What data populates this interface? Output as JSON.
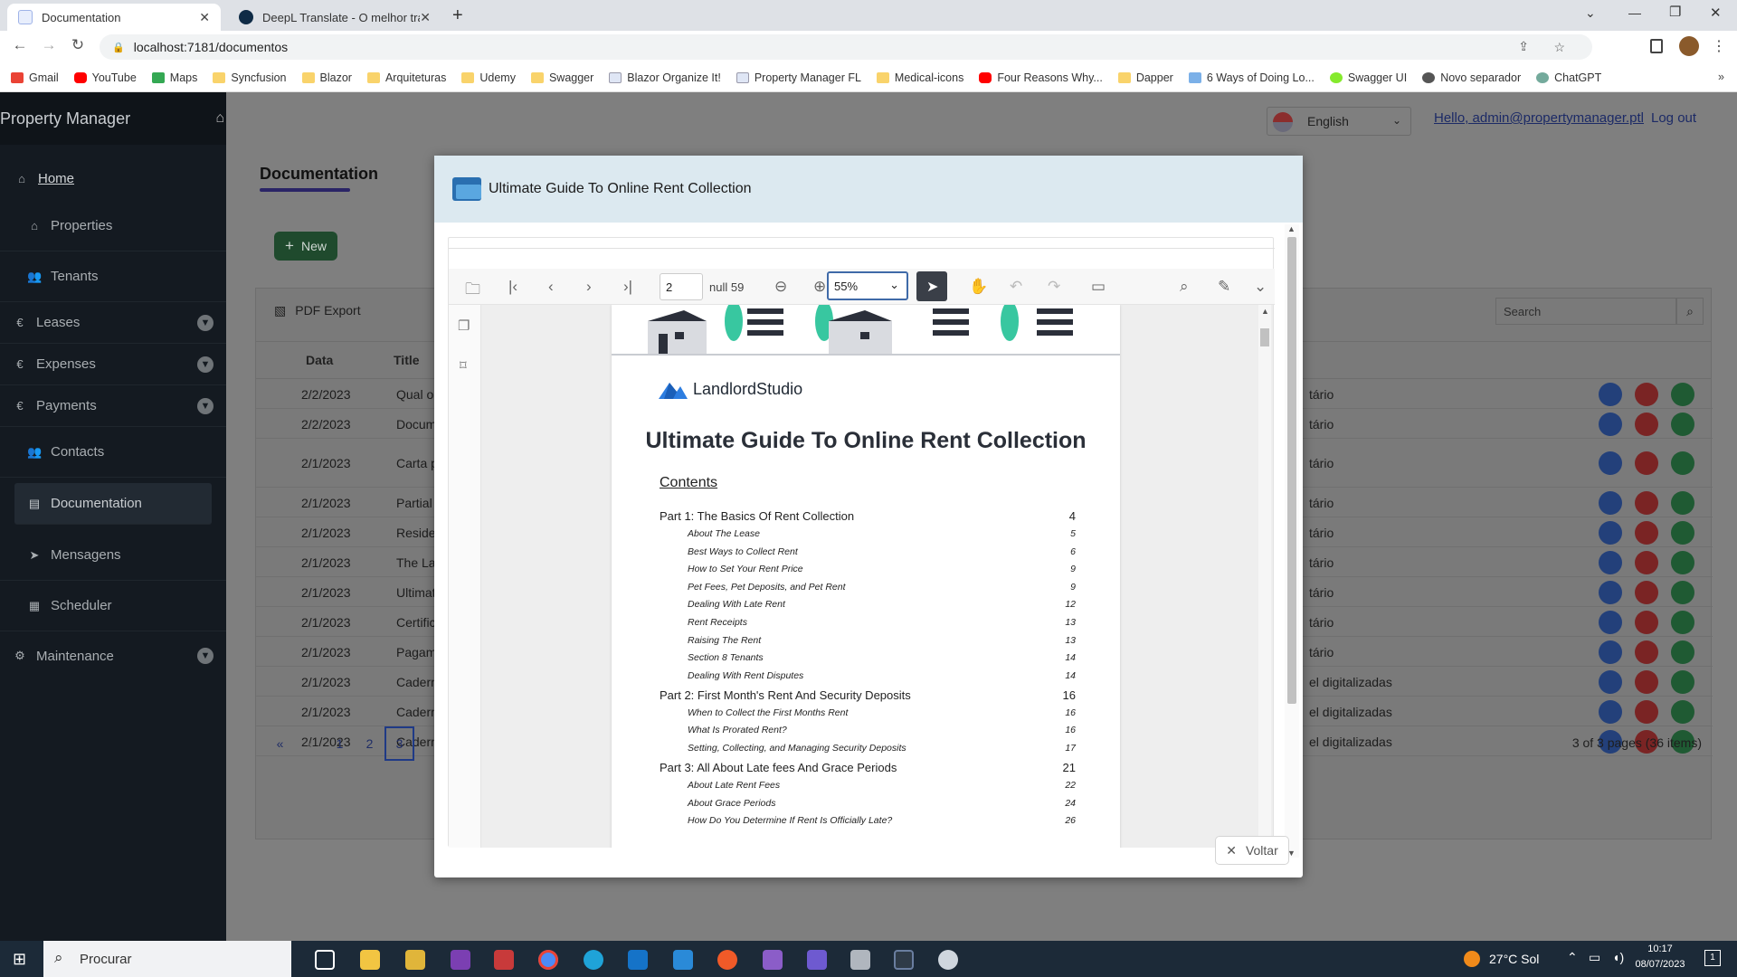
{
  "browser": {
    "tabs": [
      {
        "title": "Documentation",
        "active": true
      },
      {
        "title": "DeepL Translate - O melhor tradu",
        "active": false
      }
    ],
    "new_tab": "+",
    "url": "localhost:7181/documentos",
    "bookmarks": [
      "Gmail",
      "YouTube",
      "Maps",
      "Syncfusion",
      "Blazor",
      "Arquiteturas",
      "Udemy",
      "Swagger",
      "Blazor Organize It!",
      "Property Manager FL",
      "Medical-icons",
      "Four Reasons Why...",
      "Dapper",
      "6 Ways of Doing Lo...",
      "Swagger UI",
      "Novo separador",
      "ChatGPT"
    ]
  },
  "app": {
    "brand": "Property Manager",
    "sidebar": [
      {
        "label": "Home",
        "icon": "home-icon",
        "expandable": false
      },
      {
        "label": "Properties",
        "icon": "home-icon",
        "expandable": false
      },
      {
        "label": "Tenants",
        "icon": "users-icon",
        "expandable": false
      },
      {
        "label": "Leases",
        "icon": "euro-icon",
        "expandable": true
      },
      {
        "label": "Expenses",
        "icon": "euro-icon",
        "expandable": true
      },
      {
        "label": "Payments",
        "icon": "euro-icon",
        "expandable": true
      },
      {
        "label": "Contacts",
        "icon": "users-icon",
        "expandable": false
      },
      {
        "label": "Documentation",
        "icon": "document-icon",
        "expandable": false,
        "active": true
      },
      {
        "label": "Mensagens",
        "icon": "send-icon",
        "expandable": false
      },
      {
        "label": "Scheduler",
        "icon": "calendar-icon",
        "expandable": false
      },
      {
        "label": "Maintenance",
        "icon": "gear-icon",
        "expandable": true
      }
    ],
    "language": "English",
    "user_greeting": "Hello, admin@propertymanager.ptl",
    "logout": "Log out",
    "page_title": "Documentation",
    "new_button": "New",
    "pdf_export": "PDF Export",
    "search_placeholder": "Search",
    "columns": {
      "date": "Data",
      "title": "Title"
    },
    "rows": [
      {
        "date": "2/2/2023",
        "title": "Qual o",
        "right": "tário"
      },
      {
        "date": "2/2/2023",
        "title": "Docum",
        "right": "tário"
      },
      {
        "date": "2/1/2023",
        "title": "Carta p",
        "right": "tário"
      },
      {
        "date": "2/1/2023",
        "title": "Partial",
        "right": "tário"
      },
      {
        "date": "2/1/2023",
        "title": "Reside",
        "right": "tário"
      },
      {
        "date": "2/1/2023",
        "title": "The La",
        "right": "tário"
      },
      {
        "date": "2/1/2023",
        "title": "Ultimat",
        "right": "tário"
      },
      {
        "date": "2/1/2023",
        "title": "Certific",
        "right": "tário"
      },
      {
        "date": "2/1/2023",
        "title": "Pagam",
        "right": "tário"
      },
      {
        "date": "2/1/2023",
        "title": "Cadern",
        "right": "el digitalizadas"
      },
      {
        "date": "2/1/2023",
        "title": "Cadern",
        "right": "el digitalizadas"
      },
      {
        "date": "2/1/2023",
        "title": "Cadern",
        "right": "el digitalizadas"
      }
    ],
    "pager": {
      "first": "«",
      "prev": "‹",
      "pages": [
        "1",
        "2",
        "3"
      ],
      "current": "3",
      "summary": "3 of 3 pages (36 items)"
    }
  },
  "modal": {
    "title": "Ultimate Guide To Online Rent Collection",
    "viewer": {
      "current_page": "2",
      "page_count_label": "null 59",
      "zoom": "55%"
    },
    "document": {
      "logo_text": "LandlordStudio",
      "heading": "Ultimate Guide To Online Rent Collection",
      "contents_label": "Contents",
      "toc": [
        {
          "text": "Part 1: The Basics Of Rent Collection",
          "page": "4",
          "level": "main"
        },
        {
          "text": "About The Lease",
          "page": "5",
          "level": "sub"
        },
        {
          "text": "Best Ways to Collect Rent",
          "page": "6",
          "level": "sub"
        },
        {
          "text": "How to Set Your Rent Price",
          "page": "9",
          "level": "sub"
        },
        {
          "text": "Pet Fees, Pet Deposits, and Pet Rent",
          "page": "9",
          "level": "sub"
        },
        {
          "text": "Dealing With Late Rent",
          "page": "12",
          "level": "sub"
        },
        {
          "text": "Rent Receipts",
          "page": "13",
          "level": "sub"
        },
        {
          "text": "Raising The Rent",
          "page": "13",
          "level": "sub"
        },
        {
          "text": "Section 8 Tenants",
          "page": "14",
          "level": "sub"
        },
        {
          "text": "Dealing With Rent Disputes",
          "page": "14",
          "level": "sub"
        },
        {
          "text": "Part 2: First Month's Rent And Security Deposits",
          "page": "16",
          "level": "main"
        },
        {
          "text": "When to Collect the First Months Rent",
          "page": "16",
          "level": "sub"
        },
        {
          "text": "What Is Prorated Rent?",
          "page": "16",
          "level": "sub"
        },
        {
          "text": "Setting, Collecting, and Managing Security Deposits",
          "page": "17",
          "level": "sub"
        },
        {
          "text": "Part 3: All About Late fees And Grace Periods",
          "page": "21",
          "level": "main"
        },
        {
          "text": "About Late Rent Fees",
          "page": "22",
          "level": "sub"
        },
        {
          "text": "About Grace Periods",
          "page": "24",
          "level": "sub"
        },
        {
          "text": "How Do You Determine If Rent Is Officially Late?",
          "page": "26",
          "level": "sub"
        }
      ]
    },
    "close_button": "Voltar"
  },
  "taskbar": {
    "search": "Procurar",
    "weather": "27°C  Sol",
    "time": "10:17",
    "date": "08/07/2023",
    "notifications": "1"
  }
}
